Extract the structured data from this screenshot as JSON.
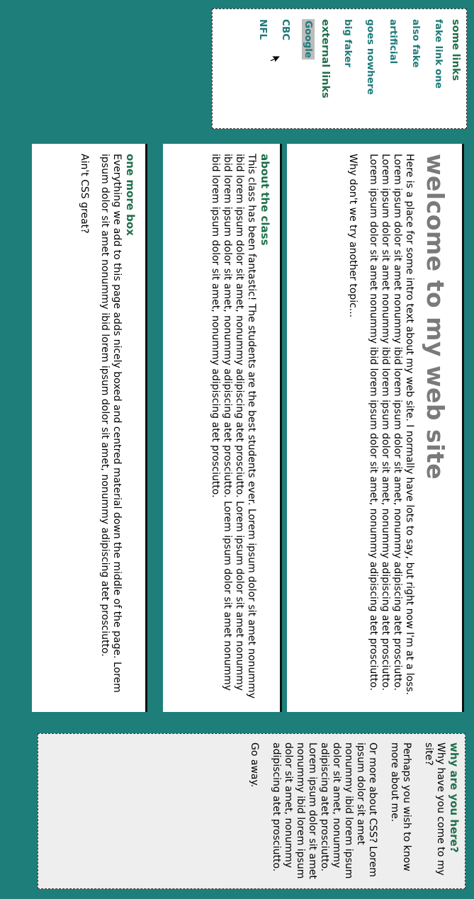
{
  "nav": {
    "groups": [
      {
        "heading": "some links",
        "links": [
          "fake link one",
          "also fake",
          "artificial",
          "goes nowhere",
          "big faker"
        ]
      },
      {
        "heading": "external links",
        "links": [
          "Google",
          "CBC",
          "NFL"
        ]
      }
    ]
  },
  "welcome": {
    "title": "welcome to my web site",
    "p1": "Here is a place for some intro text about my web site. I normally have lots to say, but right now I'm at a loss. Lorem ipsum dolor sit amet nonummy ibid lorem ipsum dolor sit amet, nonummy adipiscing atet prosciutto. Lorem ipsum dolor sit amet nonummy ibid lorem ipsum dolor sit amet, nonummy adipiscing atet prosciutto. Lorem ipsum dolor sit amet nonummy ibid lorem ipsum dolor sit amet, nonummy adipiscing atet prosciutto.",
    "p2": "Why don't we try another topic..."
  },
  "about": {
    "title": "about the class",
    "p1": "This class has been fantastic! The students are the best students ever. Lorem ipsum dolor sit amet nonummy ibid lorem ipsum dolor sit amet, nonummy adipiscing atet prosciutto. Lorem ipsum dolor sit amet nonummy ibid lorem ipsum dolor sit amet, nonummy adipiscing atet prosciutto. Lorem ipsum dolor sit amet nonummy ibid lorem ipsum dolor sit amet, nonummy adipiscing atet prosciutto."
  },
  "more": {
    "title": "one more box",
    "p1": "Everything we add to this page adds nicely boxed and centred material down the middle of the page. Lorem ipsum dolor sit amet nonummy ibid lorem ipsum dolor sit amet, nonummy adipiscing atet prosciutto.",
    "p2": "Ain't CSS great?"
  },
  "aside": {
    "title": "why are you here?",
    "p1": "Why have you come to my site?",
    "p2": "Perhaps you wish to know more about me.",
    "p3": "Or more about CSS? Lorem ipsum dolor sit amet nonummy ibid lorem ipsum dolor sit amet, nonummy adipiscing atet prosciutto. Lorem ipsum dolor sit amet nonummy ibid lorem ipsum dolor sit amet, nonummy adipiscing atet prosciutto.",
    "p4": "Go away."
  },
  "colors": {
    "background": "#1e7e7a",
    "heading_green": "#1f6f4b",
    "link_teal": "#1f7a7a",
    "title_gray": "#7a7a7a"
  },
  "icons": {
    "cursor": "mouse-pointer-icon"
  }
}
